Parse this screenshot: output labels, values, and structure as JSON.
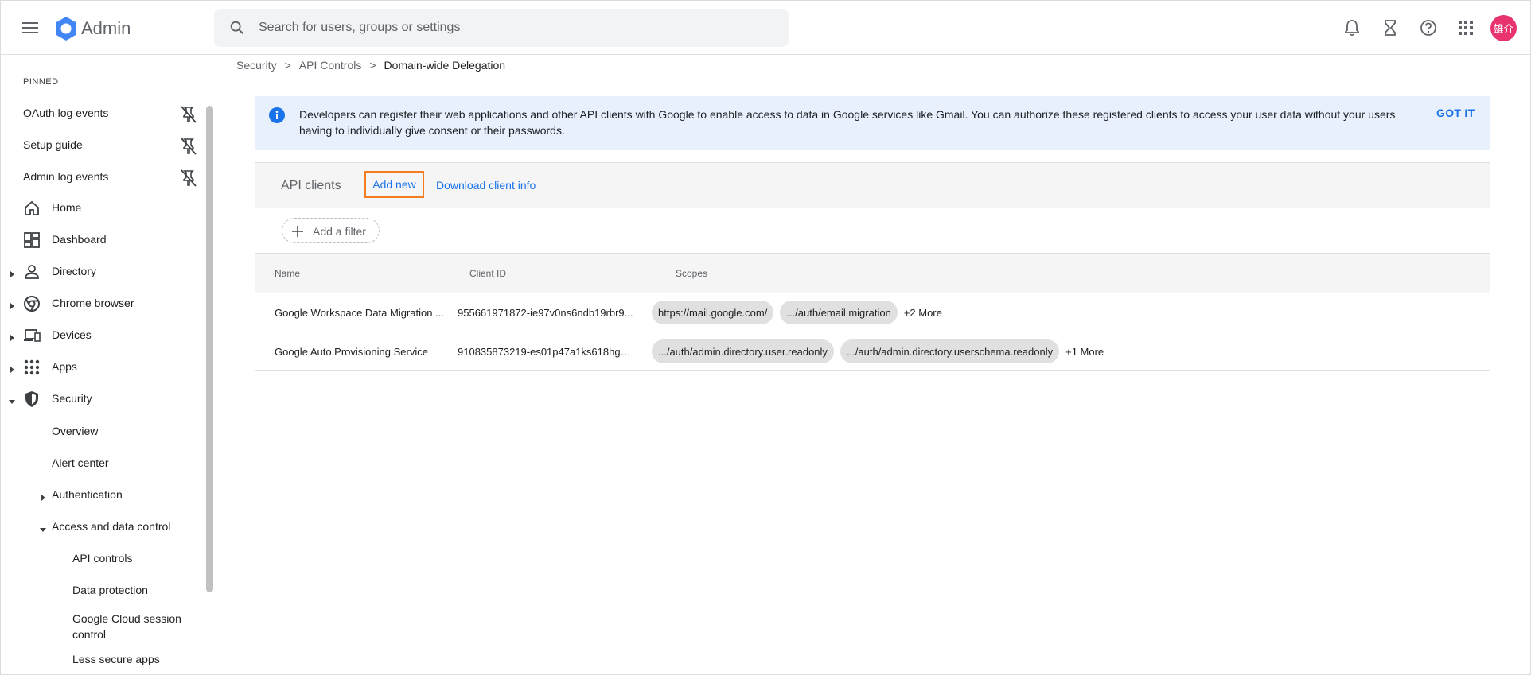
{
  "header": {
    "app_title": "Admin",
    "search_placeholder": "Search for users, groups or settings",
    "avatar_text": "雄介",
    "avatar_color": "#e8336e",
    "icons": [
      "menu-icon",
      "admin-logo",
      "search-icon",
      "bell-icon",
      "hourglass-icon",
      "help-icon",
      "apps-grid-icon"
    ]
  },
  "sidebar": {
    "pinned_label": "PINNED",
    "pinned": [
      {
        "label": "OAuth log events"
      },
      {
        "label": "Setup guide"
      },
      {
        "label": "Admin log events"
      }
    ],
    "nav": [
      {
        "label": "Home",
        "icon": "home-icon"
      },
      {
        "label": "Dashboard",
        "icon": "dashboard-icon"
      },
      {
        "label": "Directory",
        "icon": "person-icon"
      },
      {
        "label": "Chrome browser",
        "icon": "chrome-icon"
      },
      {
        "label": "Devices",
        "icon": "devices-icon"
      },
      {
        "label": "Apps",
        "icon": "apps-icon"
      },
      {
        "label": "Security",
        "icon": "shield-icon"
      }
    ],
    "security_children": [
      {
        "label": "Overview"
      },
      {
        "label": "Alert center"
      },
      {
        "label": "Authentication"
      },
      {
        "label": "Access and data control"
      }
    ],
    "access_children": [
      {
        "label": "API controls"
      },
      {
        "label": "Data protection"
      },
      {
        "label": "Google Cloud session control"
      },
      {
        "label": "Less secure apps"
      }
    ]
  },
  "breadcrumb": {
    "items": [
      "Security",
      "API Controls"
    ],
    "current": "Domain-wide Delegation",
    "separator": ">"
  },
  "banner": {
    "text": "Developers can register their web applications and other API clients with Google to enable access to data in Google services like Gmail. You can authorize these registered clients to access your user data without your users having to individually give consent or their passwords.",
    "action": "GOT IT"
  },
  "panel": {
    "title": "API clients",
    "add_new": "Add new",
    "download": "Download client info",
    "filter_label": "Add a filter",
    "columns": {
      "name": "Name",
      "client_id": "Client ID",
      "scopes": "Scopes"
    },
    "rows": [
      {
        "name": "Google Workspace Data Migration ...",
        "client_id": "955661971872-ie97v0ns6ndb19rbr9...",
        "scopes": [
          "https://mail.google.com/",
          ".../auth/email.migration"
        ],
        "more": "+2 More"
      },
      {
        "name": "Google Auto Provisioning Service",
        "client_id": "910835873219-es01p47a1ks618hgp...",
        "scopes": [
          ".../auth/admin.directory.user.readonly",
          ".../auth/admin.directory.userschema.readonly"
        ],
        "more": "+1 More"
      }
    ]
  },
  "colors": {
    "accent": "#1a73e8",
    "highlight_outline": "#f57c1f",
    "banner_bg": "#e8f0fe"
  }
}
